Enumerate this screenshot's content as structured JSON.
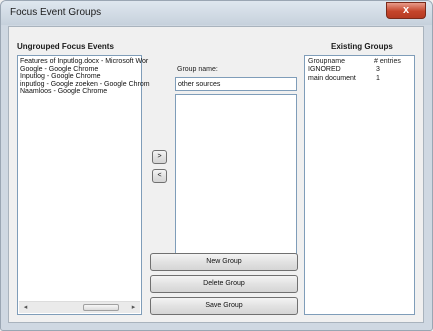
{
  "window": {
    "title": "Focus Event Groups",
    "close_glyph": "x"
  },
  "ungrouped": {
    "title": "Ungrouped Focus Events",
    "items": [
      "Features of Inputlog.docx - Microsoft Wor",
      "Google - Google Chrome",
      "Inputlog - Google Chrome",
      "inputlog - Google zoeken - Google Chrom",
      "Naamloos - Google Chrome"
    ],
    "scroll_left_glyph": "◂",
    "scroll_right_glyph": "▸"
  },
  "move": {
    "right_label": ">",
    "left_label": "<"
  },
  "group": {
    "name_label": "Group name:",
    "name_value": "other sources",
    "new_label": "New Group",
    "delete_label": "Delete Group",
    "save_label": "Save Group"
  },
  "existing": {
    "title": "Existing Groups",
    "columns": [
      "Groupname",
      "# entries"
    ],
    "rows": [
      {
        "name": "IGNORED",
        "entries": "3"
      },
      {
        "name": "main document",
        "entries": "1"
      }
    ]
  }
}
